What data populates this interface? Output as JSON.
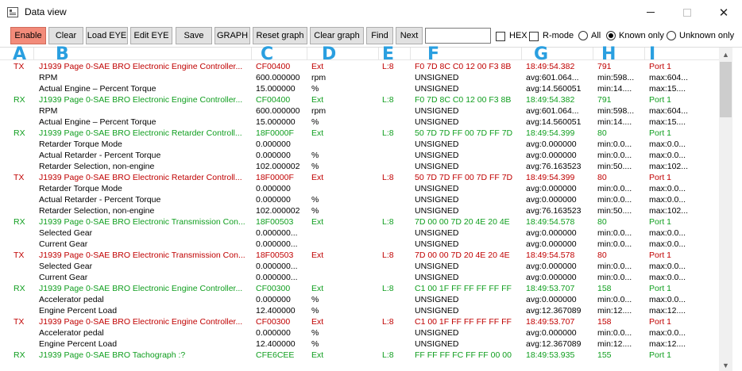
{
  "window": {
    "title": "Data view"
  },
  "toolbar": {
    "enable": "Enable",
    "clear": "Clear",
    "load_eye": "Load EYE",
    "edit_eye": "Edit EYE",
    "save": "Save",
    "graph": "GRAPH",
    "reset_graph": "Reset graph",
    "clear_graph": "Clear graph",
    "find": "Find",
    "next": "Next",
    "search_value": "",
    "hex_label": "HEX",
    "rmode_label": "R-mode",
    "all_label": "All",
    "known_only_label": "Known only",
    "unknown_only_label": "Unknown only",
    "selected_filter": "Known only"
  },
  "column_letters": [
    "A",
    "B",
    "C",
    "D",
    "E",
    "F",
    "G",
    "H",
    "I"
  ],
  "colors": {
    "tx": "#c00000",
    "rx": "#0f9e1e",
    "letters": "#2a9fe0",
    "enable_button": "#f28b7a"
  },
  "rows": [
    {
      "kind": "tx",
      "dir": "TX",
      "name": "J1939 Page 0-SAE BRO Electronic Engine Controller...",
      "id": "CF00400",
      "unit": "Ext",
      "len": "L:8",
      "data": "F0 7D 8C C0 12 00 F3 8B",
      "time": "18:49:54.382",
      "stat": "791",
      "port": "Port 1"
    },
    {
      "kind": "sub",
      "dir": "",
      "name": "RPM",
      "id": "600.000000",
      "unit": "rpm",
      "len": "",
      "data": "UNSIGNED",
      "time": "avg:601.064...",
      "stat": "min:598...",
      "port": "max:604..."
    },
    {
      "kind": "sub",
      "dir": "",
      "name": "Actual Engine – Percent Torque",
      "id": "15.000000",
      "unit": "%",
      "len": "",
      "data": "UNSIGNED",
      "time": "avg:14.560051",
      "stat": "min:14....",
      "port": "max:15...."
    },
    {
      "kind": "rx",
      "dir": "RX",
      "name": "J1939 Page 0-SAE BRO Electronic Engine Controller...",
      "id": "CF00400",
      "unit": "Ext",
      "len": "L:8",
      "data": "F0 7D 8C C0 12 00 F3 8B",
      "time": "18:49:54.382",
      "stat": "791",
      "port": "Port 1"
    },
    {
      "kind": "sub",
      "dir": "",
      "name": "RPM",
      "id": "600.000000",
      "unit": "rpm",
      "len": "",
      "data": "UNSIGNED",
      "time": "avg:601.064...",
      "stat": "min:598...",
      "port": "max:604..."
    },
    {
      "kind": "sub",
      "dir": "",
      "name": "Actual Engine – Percent Torque",
      "id": "15.000000",
      "unit": "%",
      "len": "",
      "data": "UNSIGNED",
      "time": "avg:14.560051",
      "stat": "min:14....",
      "port": "max:15...."
    },
    {
      "kind": "rx",
      "dir": "RX",
      "name": "J1939 Page 0-SAE BRO Electronic Retarder Controll...",
      "id": "18F0000F",
      "unit": "Ext",
      "len": "L:8",
      "data": "50 7D 7D FF 00 7D FF 7D",
      "time": "18:49:54.399",
      "stat": "80",
      "port": "Port 1"
    },
    {
      "kind": "sub",
      "dir": "",
      "name": "Retarder Torque Mode",
      "id": "0.000000",
      "unit": "",
      "len": "",
      "data": "UNSIGNED",
      "time": "avg:0.000000",
      "stat": "min:0.0...",
      "port": "max:0.0..."
    },
    {
      "kind": "sub",
      "dir": "",
      "name": "Actual Retarder - Percent Torque",
      "id": "0.000000",
      "unit": "%",
      "len": "",
      "data": "UNSIGNED",
      "time": "avg:0.000000",
      "stat": "min:0.0...",
      "port": "max:0.0..."
    },
    {
      "kind": "sub",
      "dir": "",
      "name": "Retarder Selection, non-engine",
      "id": "102.000002",
      "unit": "%",
      "len": "",
      "data": "UNSIGNED",
      "time": "avg:76.163523",
      "stat": "min:50....",
      "port": "max:102..."
    },
    {
      "kind": "tx",
      "dir": "TX",
      "name": "J1939 Page 0-SAE BRO Electronic Retarder Controll...",
      "id": "18F0000F",
      "unit": "Ext",
      "len": "L:8",
      "data": "50 7D 7D FF 00 7D FF 7D",
      "time": "18:49:54.399",
      "stat": "80",
      "port": "Port 1"
    },
    {
      "kind": "sub",
      "dir": "",
      "name": "Retarder Torque Mode",
      "id": "0.000000",
      "unit": "",
      "len": "",
      "data": "UNSIGNED",
      "time": "avg:0.000000",
      "stat": "min:0.0...",
      "port": "max:0.0..."
    },
    {
      "kind": "sub",
      "dir": "",
      "name": "Actual Retarder - Percent Torque",
      "id": "0.000000",
      "unit": "%",
      "len": "",
      "data": "UNSIGNED",
      "time": "avg:0.000000",
      "stat": "min:0.0...",
      "port": "max:0.0..."
    },
    {
      "kind": "sub",
      "dir": "",
      "name": "Retarder Selection, non-engine",
      "id": "102.000002",
      "unit": "%",
      "len": "",
      "data": "UNSIGNED",
      "time": "avg:76.163523",
      "stat": "min:50....",
      "port": "max:102..."
    },
    {
      "kind": "rx",
      "dir": "RX",
      "name": "J1939 Page 0-SAE BRO Electronic Transmission Con...",
      "id": "18F00503",
      "unit": "Ext",
      "len": "L:8",
      "data": "7D 00 00 7D 20 4E 20 4E",
      "time": "18:49:54.578",
      "stat": "80",
      "port": "Port 1"
    },
    {
      "kind": "sub",
      "dir": "",
      "name": "Selected Gear",
      "id": "0.000000...",
      "unit": "",
      "len": "",
      "data": "UNSIGNED",
      "time": "avg:0.000000",
      "stat": "min:0.0...",
      "port": "max:0.0..."
    },
    {
      "kind": "sub",
      "dir": "",
      "name": "Current Gear",
      "id": "0.000000...",
      "unit": "",
      "len": "",
      "data": "UNSIGNED",
      "time": "avg:0.000000",
      "stat": "min:0.0...",
      "port": "max:0.0..."
    },
    {
      "kind": "tx",
      "dir": "TX",
      "name": "J1939 Page 0-SAE BRO Electronic Transmission Con...",
      "id": "18F00503",
      "unit": "Ext",
      "len": "L:8",
      "data": "7D 00 00 7D 20 4E 20 4E",
      "time": "18:49:54.578",
      "stat": "80",
      "port": "Port 1"
    },
    {
      "kind": "sub",
      "dir": "",
      "name": "Selected Gear",
      "id": "0.000000...",
      "unit": "",
      "len": "",
      "data": "UNSIGNED",
      "time": "avg:0.000000",
      "stat": "min:0.0...",
      "port": "max:0.0..."
    },
    {
      "kind": "sub",
      "dir": "",
      "name": "Current Gear",
      "id": "0.000000...",
      "unit": "",
      "len": "",
      "data": "UNSIGNED",
      "time": "avg:0.000000",
      "stat": "min:0.0...",
      "port": "max:0.0..."
    },
    {
      "kind": "rx",
      "dir": "RX",
      "name": "J1939 Page 0-SAE BRO Electronic Engine Controller...",
      "id": "CF00300",
      "unit": "Ext",
      "len": "L:8",
      "data": "C1 00 1F FF FF FF FF FF",
      "time": "18:49:53.707",
      "stat": "158",
      "port": "Port 1"
    },
    {
      "kind": "sub",
      "dir": "",
      "name": "Accelerator pedal",
      "id": "0.000000",
      "unit": "%",
      "len": "",
      "data": "UNSIGNED",
      "time": "avg:0.000000",
      "stat": "min:0.0...",
      "port": "max:0.0..."
    },
    {
      "kind": "sub",
      "dir": "",
      "name": "Engine Percent Load",
      "id": "12.400000",
      "unit": "%",
      "len": "",
      "data": "UNSIGNED",
      "time": "avg:12.367089",
      "stat": "min:12....",
      "port": "max:12...."
    },
    {
      "kind": "tx",
      "dir": "TX",
      "name": "J1939 Page 0-SAE BRO Electronic Engine Controller...",
      "id": "CF00300",
      "unit": "Ext",
      "len": "L:8",
      "data": "C1 00 1F FF FF FF FF FF",
      "time": "18:49:53.707",
      "stat": "158",
      "port": "Port 1"
    },
    {
      "kind": "sub",
      "dir": "",
      "name": "Accelerator pedal",
      "id": "0.000000",
      "unit": "%",
      "len": "",
      "data": "UNSIGNED",
      "time": "avg:0.000000",
      "stat": "min:0.0...",
      "port": "max:0.0..."
    },
    {
      "kind": "sub",
      "dir": "",
      "name": "Engine Percent Load",
      "id": "12.400000",
      "unit": "%",
      "len": "",
      "data": "UNSIGNED",
      "time": "avg:12.367089",
      "stat": "min:12....",
      "port": "max:12...."
    },
    {
      "kind": "rx",
      "dir": "RX",
      "name": "J1939 Page 0-SAE BRO Tachograph :?",
      "id": "CFE6CEE",
      "unit": "Ext",
      "len": "L:8",
      "data": "FF FF FF FC FF FF 00 00",
      "time": "18:49:53.935",
      "stat": "155",
      "port": "Port 1"
    }
  ]
}
